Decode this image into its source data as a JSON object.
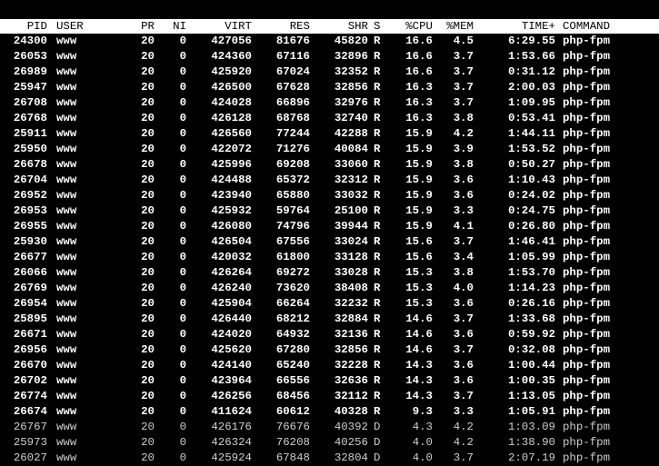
{
  "columns": {
    "pid": "PID",
    "user": "USER",
    "pr": "PR",
    "ni": "NI",
    "virt": "VIRT",
    "res": "RES",
    "shr": "SHR",
    "s": "S",
    "cpu": "%CPU",
    "mem": "%MEM",
    "time": "TIME+",
    "command": "COMMAND"
  },
  "processes": [
    {
      "pid": "24300",
      "user": "www",
      "pr": "20",
      "ni": "0",
      "virt": "427056",
      "res": "81676",
      "shr": "45820",
      "s": "R",
      "cpu": "16.6",
      "mem": "4.5",
      "time": "6:29.55",
      "command": "php-fpm"
    },
    {
      "pid": "26053",
      "user": "www",
      "pr": "20",
      "ni": "0",
      "virt": "424360",
      "res": "67116",
      "shr": "32896",
      "s": "R",
      "cpu": "16.6",
      "mem": "3.7",
      "time": "1:53.66",
      "command": "php-fpm"
    },
    {
      "pid": "26989",
      "user": "www",
      "pr": "20",
      "ni": "0",
      "virt": "425920",
      "res": "67024",
      "shr": "32352",
      "s": "R",
      "cpu": "16.6",
      "mem": "3.7",
      "time": "0:31.12",
      "command": "php-fpm"
    },
    {
      "pid": "25947",
      "user": "www",
      "pr": "20",
      "ni": "0",
      "virt": "426500",
      "res": "67628",
      "shr": "32856",
      "s": "R",
      "cpu": "16.3",
      "mem": "3.7",
      "time": "2:00.03",
      "command": "php-fpm"
    },
    {
      "pid": "26708",
      "user": "www",
      "pr": "20",
      "ni": "0",
      "virt": "424028",
      "res": "66896",
      "shr": "32976",
      "s": "R",
      "cpu": "16.3",
      "mem": "3.7",
      "time": "1:09.95",
      "command": "php-fpm"
    },
    {
      "pid": "26768",
      "user": "www",
      "pr": "20",
      "ni": "0",
      "virt": "426128",
      "res": "68768",
      "shr": "32740",
      "s": "R",
      "cpu": "16.3",
      "mem": "3.8",
      "time": "0:53.41",
      "command": "php-fpm"
    },
    {
      "pid": "25911",
      "user": "www",
      "pr": "20",
      "ni": "0",
      "virt": "426560",
      "res": "77244",
      "shr": "42288",
      "s": "R",
      "cpu": "15.9",
      "mem": "4.2",
      "time": "1:44.11",
      "command": "php-fpm"
    },
    {
      "pid": "25950",
      "user": "www",
      "pr": "20",
      "ni": "0",
      "virt": "422072",
      "res": "71276",
      "shr": "40084",
      "s": "R",
      "cpu": "15.9",
      "mem": "3.9",
      "time": "1:53.52",
      "command": "php-fpm"
    },
    {
      "pid": "26678",
      "user": "www",
      "pr": "20",
      "ni": "0",
      "virt": "425996",
      "res": "69208",
      "shr": "33060",
      "s": "R",
      "cpu": "15.9",
      "mem": "3.8",
      "time": "0:50.27",
      "command": "php-fpm"
    },
    {
      "pid": "26704",
      "user": "www",
      "pr": "20",
      "ni": "0",
      "virt": "424488",
      "res": "65372",
      "shr": "32312",
      "s": "R",
      "cpu": "15.9",
      "mem": "3.6",
      "time": "1:10.43",
      "command": "php-fpm"
    },
    {
      "pid": "26952",
      "user": "www",
      "pr": "20",
      "ni": "0",
      "virt": "423940",
      "res": "65880",
      "shr": "33032",
      "s": "R",
      "cpu": "15.9",
      "mem": "3.6",
      "time": "0:24.02",
      "command": "php-fpm"
    },
    {
      "pid": "26953",
      "user": "www",
      "pr": "20",
      "ni": "0",
      "virt": "425932",
      "res": "59764",
      "shr": "25100",
      "s": "R",
      "cpu": "15.9",
      "mem": "3.3",
      "time": "0:24.75",
      "command": "php-fpm"
    },
    {
      "pid": "26955",
      "user": "www",
      "pr": "20",
      "ni": "0",
      "virt": "426080",
      "res": "74796",
      "shr": "39944",
      "s": "R",
      "cpu": "15.9",
      "mem": "4.1",
      "time": "0:26.80",
      "command": "php-fpm"
    },
    {
      "pid": "25930",
      "user": "www",
      "pr": "20",
      "ni": "0",
      "virt": "426504",
      "res": "67556",
      "shr": "33024",
      "s": "R",
      "cpu": "15.6",
      "mem": "3.7",
      "time": "1:46.41",
      "command": "php-fpm"
    },
    {
      "pid": "26677",
      "user": "www",
      "pr": "20",
      "ni": "0",
      "virt": "420032",
      "res": "61800",
      "shr": "33128",
      "s": "R",
      "cpu": "15.6",
      "mem": "3.4",
      "time": "1:05.99",
      "command": "php-fpm"
    },
    {
      "pid": "26066",
      "user": "www",
      "pr": "20",
      "ni": "0",
      "virt": "426264",
      "res": "69272",
      "shr": "33028",
      "s": "R",
      "cpu": "15.3",
      "mem": "3.8",
      "time": "1:53.70",
      "command": "php-fpm"
    },
    {
      "pid": "26769",
      "user": "www",
      "pr": "20",
      "ni": "0",
      "virt": "426240",
      "res": "73620",
      "shr": "38408",
      "s": "R",
      "cpu": "15.3",
      "mem": "4.0",
      "time": "1:14.23",
      "command": "php-fpm"
    },
    {
      "pid": "26954",
      "user": "www",
      "pr": "20",
      "ni": "0",
      "virt": "425904",
      "res": "66264",
      "shr": "32232",
      "s": "R",
      "cpu": "15.3",
      "mem": "3.6",
      "time": "0:26.16",
      "command": "php-fpm"
    },
    {
      "pid": "25895",
      "user": "www",
      "pr": "20",
      "ni": "0",
      "virt": "426440",
      "res": "68212",
      "shr": "32884",
      "s": "R",
      "cpu": "14.6",
      "mem": "3.7",
      "time": "1:33.68",
      "command": "php-fpm"
    },
    {
      "pid": "26671",
      "user": "www",
      "pr": "20",
      "ni": "0",
      "virt": "424020",
      "res": "64932",
      "shr": "32136",
      "s": "R",
      "cpu": "14.6",
      "mem": "3.6",
      "time": "0:59.92",
      "command": "php-fpm"
    },
    {
      "pid": "26956",
      "user": "www",
      "pr": "20",
      "ni": "0",
      "virt": "425620",
      "res": "67280",
      "shr": "32856",
      "s": "R",
      "cpu": "14.6",
      "mem": "3.7",
      "time": "0:32.08",
      "command": "php-fpm"
    },
    {
      "pid": "26670",
      "user": "www",
      "pr": "20",
      "ni": "0",
      "virt": "424140",
      "res": "65240",
      "shr": "32228",
      "s": "R",
      "cpu": "14.3",
      "mem": "3.6",
      "time": "1:00.44",
      "command": "php-fpm"
    },
    {
      "pid": "26702",
      "user": "www",
      "pr": "20",
      "ni": "0",
      "virt": "423964",
      "res": "66556",
      "shr": "32636",
      "s": "R",
      "cpu": "14.3",
      "mem": "3.6",
      "time": "1:00.35",
      "command": "php-fpm"
    },
    {
      "pid": "26774",
      "user": "www",
      "pr": "20",
      "ni": "0",
      "virt": "426256",
      "res": "68456",
      "shr": "32112",
      "s": "R",
      "cpu": "14.3",
      "mem": "3.7",
      "time": "1:13.05",
      "command": "php-fpm"
    },
    {
      "pid": "26674",
      "user": "www",
      "pr": "20",
      "ni": "0",
      "virt": "411624",
      "res": "60612",
      "shr": "40328",
      "s": "R",
      "cpu": "9.3",
      "mem": "3.3",
      "time": "1:05.91",
      "command": "php-fpm"
    },
    {
      "pid": "26767",
      "user": "www",
      "pr": "20",
      "ni": "0",
      "virt": "426176",
      "res": "76676",
      "shr": "40392",
      "s": "D",
      "cpu": "4.3",
      "mem": "4.2",
      "time": "1:03.09",
      "command": "php-fpm"
    },
    {
      "pid": "25973",
      "user": "www",
      "pr": "20",
      "ni": "0",
      "virt": "426324",
      "res": "76208",
      "shr": "40256",
      "s": "D",
      "cpu": "4.0",
      "mem": "4.2",
      "time": "1:38.90",
      "command": "php-fpm"
    },
    {
      "pid": "26027",
      "user": "www",
      "pr": "20",
      "ni": "0",
      "virt": "425924",
      "res": "67848",
      "shr": "32804",
      "s": "D",
      "cpu": "4.0",
      "mem": "3.7",
      "time": "2:07.19",
      "command": "php-fpm"
    }
  ]
}
